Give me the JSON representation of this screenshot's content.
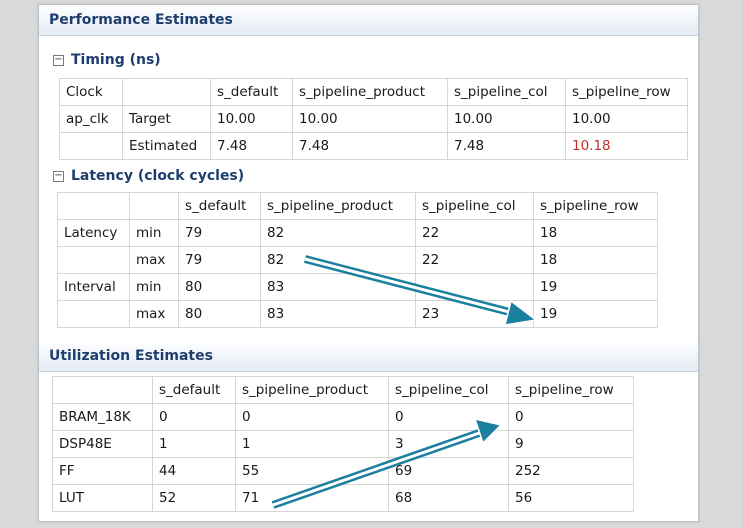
{
  "performance": {
    "title": "Performance Estimates",
    "timing": {
      "title": "Timing (ns)",
      "toggle": "−",
      "headers": [
        "Clock",
        "",
        "s_default",
        "s_pipeline_product",
        "s_pipeline_col",
        "s_pipeline_row"
      ],
      "rows": [
        [
          "ap_clk",
          "Target",
          "10.00",
          "10.00",
          "10.00",
          "10.00"
        ],
        [
          "",
          "Estimated",
          "7.48",
          "7.48",
          "7.48",
          "10.18"
        ]
      ],
      "highlight_color": "#c0312b"
    },
    "latency": {
      "title": "Latency (clock cycles)",
      "toggle": "−",
      "headers": [
        "",
        "",
        "s_default",
        "s_pipeline_product",
        "s_pipeline_col",
        "s_pipeline_row"
      ],
      "rows": [
        [
          "Latency",
          "min",
          "79",
          "82",
          "22",
          "18"
        ],
        [
          "",
          "max",
          "79",
          "82",
          "22",
          "18"
        ],
        [
          "Interval",
          "min",
          "80",
          "83",
          "",
          "19"
        ],
        [
          "",
          "max",
          "80",
          "83",
          "23",
          "19"
        ]
      ]
    }
  },
  "utilization": {
    "title": "Utilization Estimates",
    "headers": [
      "",
      "s_default",
      "s_pipeline_product",
      "s_pipeline_col",
      "s_pipeline_row"
    ],
    "rows": [
      [
        "BRAM_18K",
        "0",
        "0",
        "0",
        "0"
      ],
      [
        "DSP48E",
        "1",
        "1",
        "3",
        "9"
      ],
      [
        "FF",
        "44",
        "55",
        "69",
        "252"
      ],
      [
        "LUT",
        "52",
        "71",
        "68",
        "56"
      ]
    ]
  },
  "annotation_color": "#1b7f9e"
}
